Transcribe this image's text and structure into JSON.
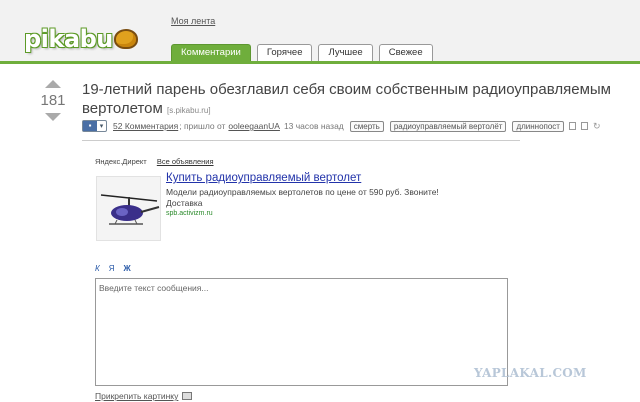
{
  "header": {
    "logo_text": "pikabu",
    "feed_link": "Моя лента",
    "tabs": [
      {
        "label": "Комментарии",
        "active": true
      },
      {
        "label": "Горячее",
        "active": false
      },
      {
        "label": "Лучшее",
        "active": false
      },
      {
        "label": "Свежее",
        "active": false
      }
    ],
    "accent_color": "#6fae3c"
  },
  "post": {
    "rating": "181",
    "title": "19-летний парень обезглавил себя своим собственным радиоуправляемым вертолетом",
    "source": "[s.pikabu.ru]",
    "comments_link": "52 Комментария",
    "posted_prefix": "; пришло от",
    "author": "ooleegaanUA",
    "time": "13 часов назад",
    "tags": [
      "смерть",
      "радиоуправляемый вертолёт",
      "длиннопост"
    ]
  },
  "ad": {
    "direct_label": "Яндекс.Директ",
    "all_ads_link": "Все объявления",
    "title": "Купить радиоуправляемый вертолет",
    "text": "Модели радиоуправляемых вертолетов по цене от 590 руб. Звоните! Доставка",
    "domain": "spb.activizm.ru"
  },
  "comment_form": {
    "format_buttons": [
      "К",
      "Я",
      "Ж"
    ],
    "placeholder": "Введите текст сообщения...",
    "attach_link": "Прикрепить картинку"
  },
  "watermark": "YAPLAKAL.COM"
}
